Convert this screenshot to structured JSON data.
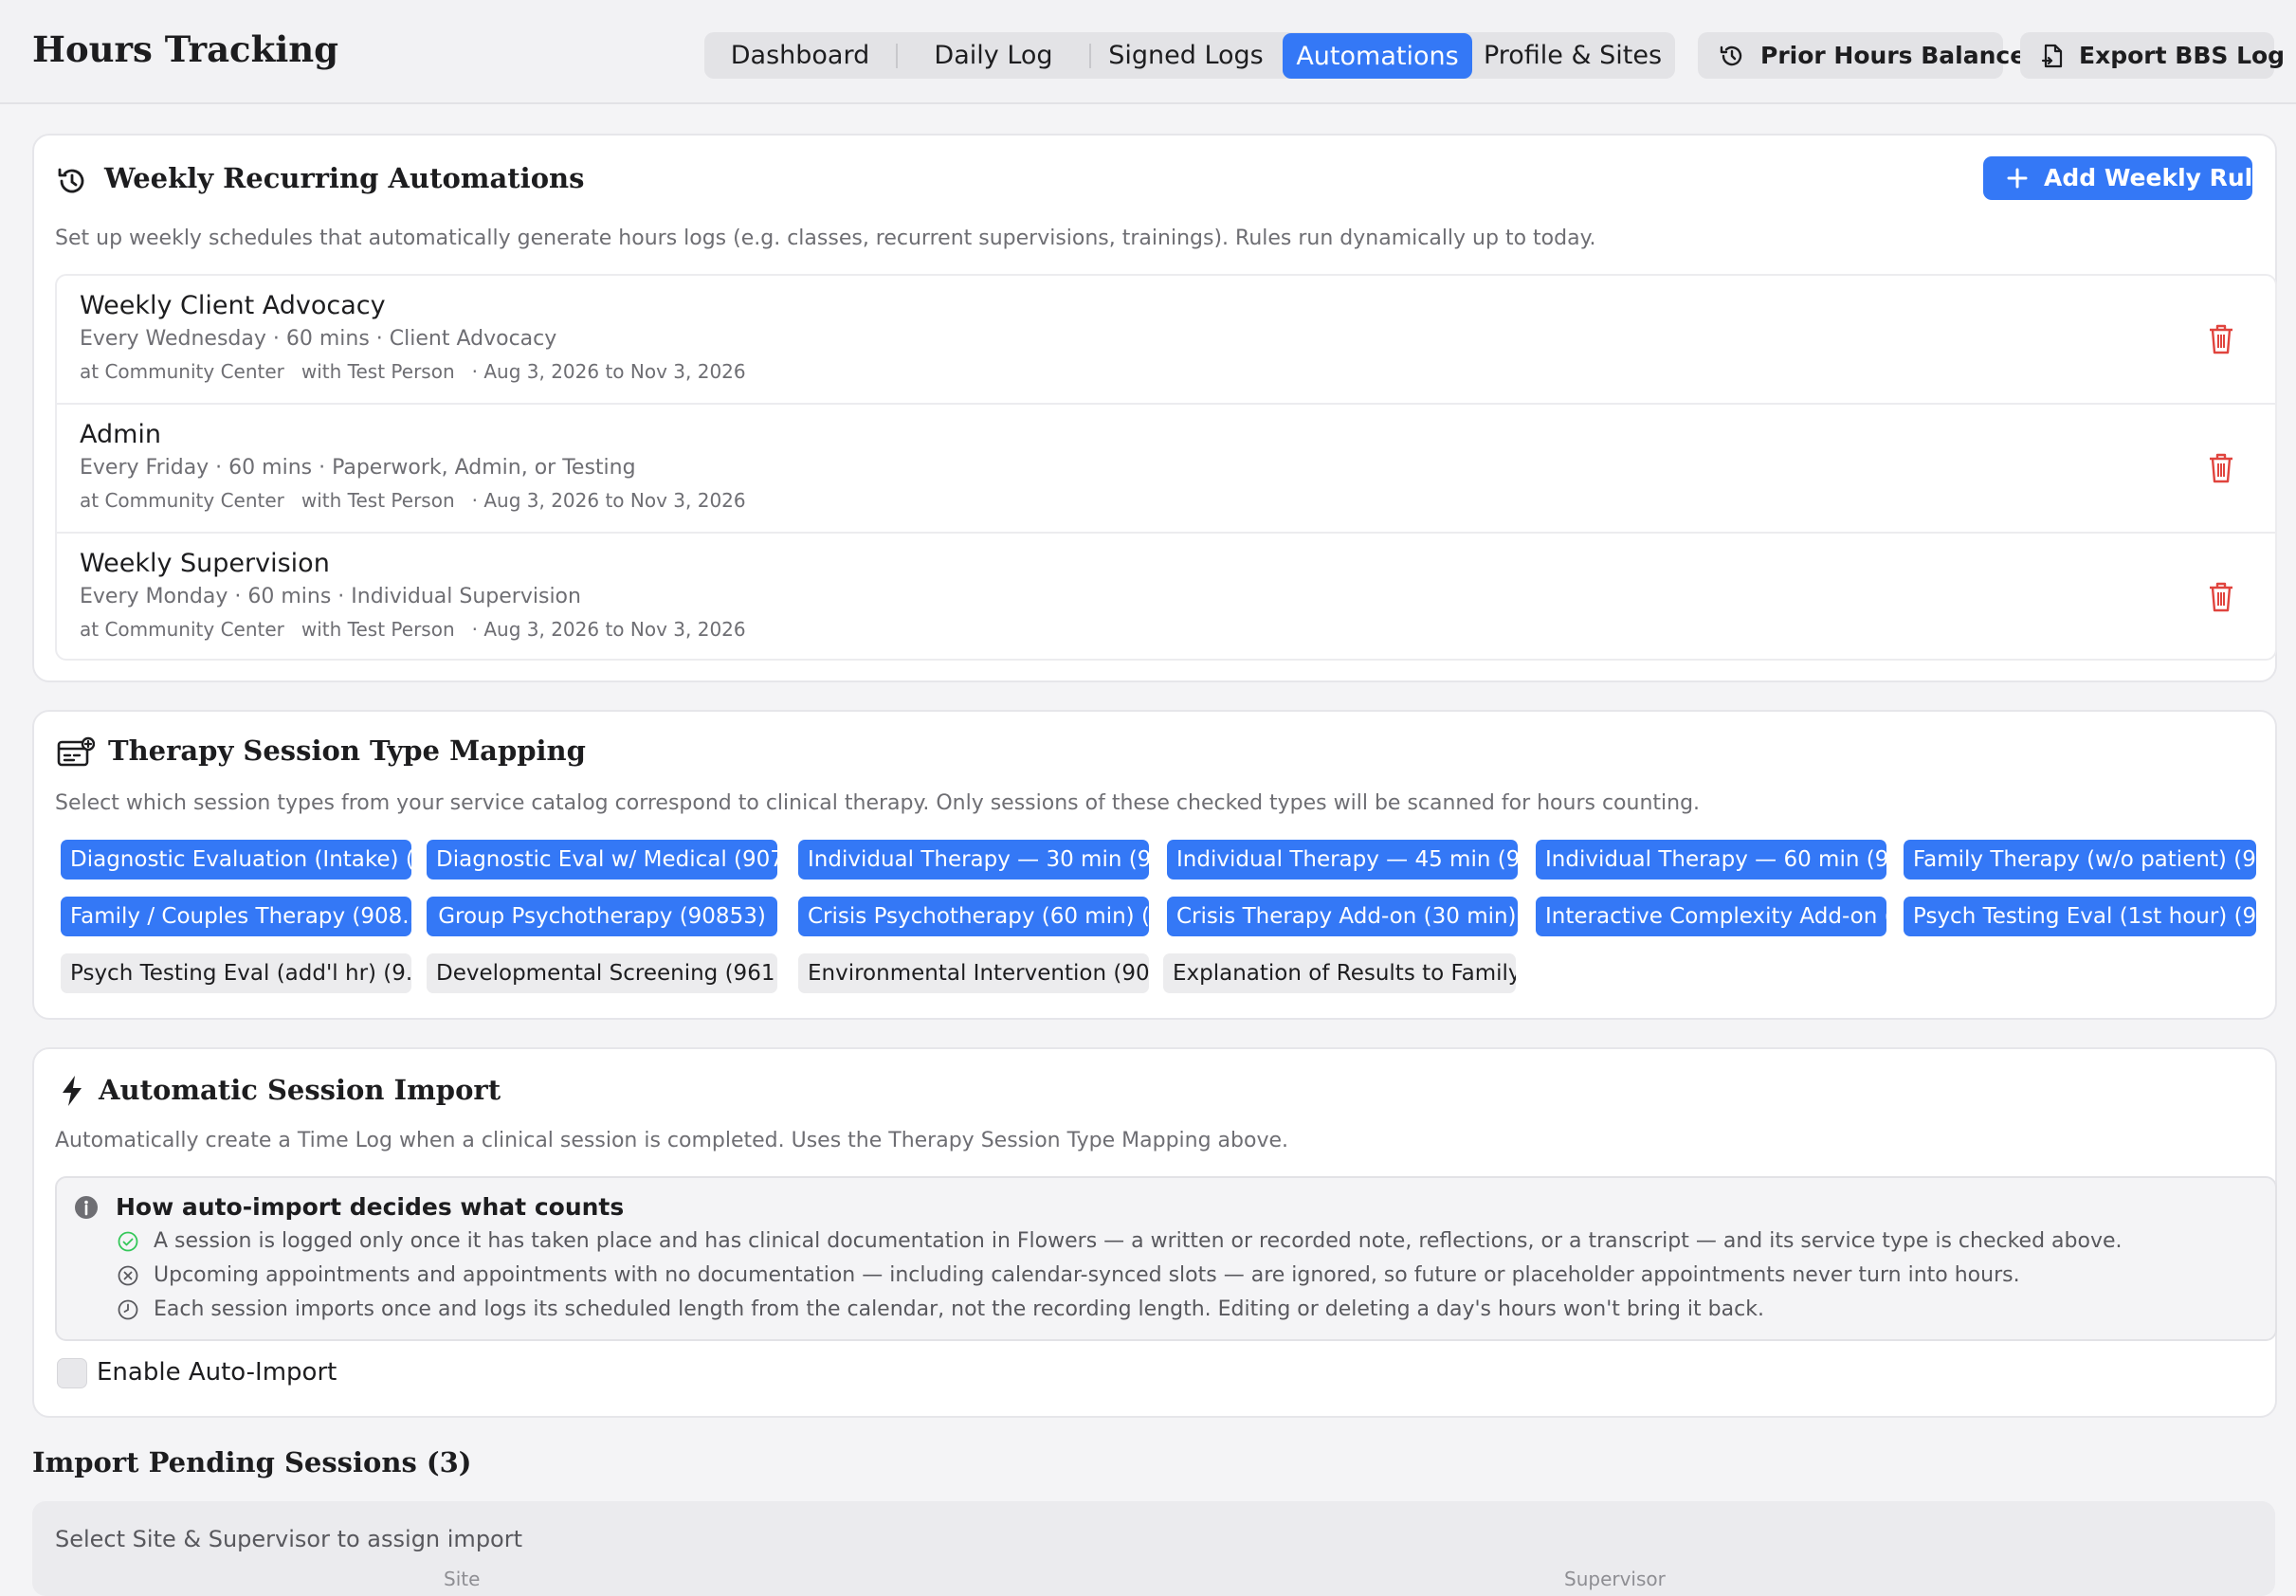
{
  "app": {
    "title": "Hours Tracking"
  },
  "nav": {
    "tabs": [
      {
        "label": "Dashboard",
        "active": false
      },
      {
        "label": "Daily Log",
        "active": false
      },
      {
        "label": "Signed Logs",
        "active": false
      },
      {
        "label": "Automations",
        "active": true
      },
      {
        "label": "Profile & Sites",
        "active": false
      }
    ],
    "prior_hours_label": "Prior Hours Balance",
    "export_label": "Export BBS Log"
  },
  "weekly": {
    "title": "Weekly Recurring Automations",
    "add_label": "Add Weekly Rule",
    "description": "Set up weekly schedules that automatically generate hours logs (e.g. classes, recurrent supervisions, trainings). Rules run dynamically up to today.",
    "rules": [
      {
        "name": "Weekly Client Advocacy",
        "meta": "Every Wednesday · 60 mins · Client Advocacy",
        "site": "at Community Center",
        "person": "with Test Person",
        "range": "· Aug 3, 2026 to Nov 3, 2026"
      },
      {
        "name": "Admin",
        "meta": "Every Friday · 60 mins · Paperwork, Admin, or Testing",
        "site": "at Community Center",
        "person": "with Test Person",
        "range": "· Aug 3, 2026 to Nov 3, 2026"
      },
      {
        "name": "Weekly Supervision",
        "meta": "Every Monday · 60 mins · Individual Supervision",
        "site": "at Community Center",
        "person": "with Test Person",
        "range": "· Aug 3, 2026 to Nov 3, 2026"
      }
    ]
  },
  "mapping": {
    "title": "Therapy Session Type Mapping",
    "description": "Select which session types from your service catalog correspond to clinical therapy. Only sessions of these checked types will be scanned for hours counting.",
    "chips": [
      {
        "label": "Diagnostic Evaluation (Intake) (...",
        "checked": true
      },
      {
        "label": "Diagnostic Eval w/ Medical (907...",
        "checked": true
      },
      {
        "label": "Individual Therapy — 30 min (9...",
        "checked": true
      },
      {
        "label": "Individual Therapy — 45 min (9...",
        "checked": true
      },
      {
        "label": "Individual Therapy — 60 min (9...",
        "checked": true
      },
      {
        "label": "Family Therapy (w/o patient) (9...",
        "checked": true
      },
      {
        "label": "Family / Couples Therapy (908...",
        "checked": true
      },
      {
        "label": "Group Psychotherapy (90853)",
        "checked": true
      },
      {
        "label": "Crisis Psychotherapy (60 min) (...",
        "checked": true
      },
      {
        "label": "Crisis Therapy Add-on (30 min)...",
        "checked": true
      },
      {
        "label": "Interactive Complexity Add-on (...",
        "checked": true
      },
      {
        "label": "Psych Testing Eval (1st hour) (9...",
        "checked": true
      },
      {
        "label": "Psych Testing Eval (add'l hr) (9...",
        "checked": false
      },
      {
        "label": "Developmental Screening (9611...",
        "checked": false
      },
      {
        "label": "Environmental Intervention (90...",
        "checked": false
      },
      {
        "label": "Explanation of Results to Family...",
        "checked": false
      }
    ]
  },
  "auto_import": {
    "title": "Automatic Session Import",
    "description": "Automatically create a Time Log when a clinical session is completed. Uses the Therapy Session Type Mapping above.",
    "how_title": "How auto-import decides what counts",
    "how_lines": [
      "A session is logged only once it has taken place and has clinical documentation in Flowers — a written or recorded note, reflections, or a transcript — and its service type is checked above.",
      "Upcoming appointments and appointments with no documentation — including calendar-synced slots — are ignored, so future or placeholder appointments never turn into hours.",
      "Each session imports once and logs its scheduled length from the calendar, not the recording length. Editing or deleting a day's hours won't bring it back."
    ],
    "enable_label": "Enable Auto-Import",
    "enabled": false
  },
  "pending": {
    "title": "Import Pending Sessions (3)",
    "assign_label": "Select Site & Supervisor to assign import",
    "site_label": "Site",
    "supervisor_label": "Supervisor"
  },
  "colors": {
    "accent": "#3478f6",
    "danger": "#e0443e",
    "success": "#34c759"
  }
}
